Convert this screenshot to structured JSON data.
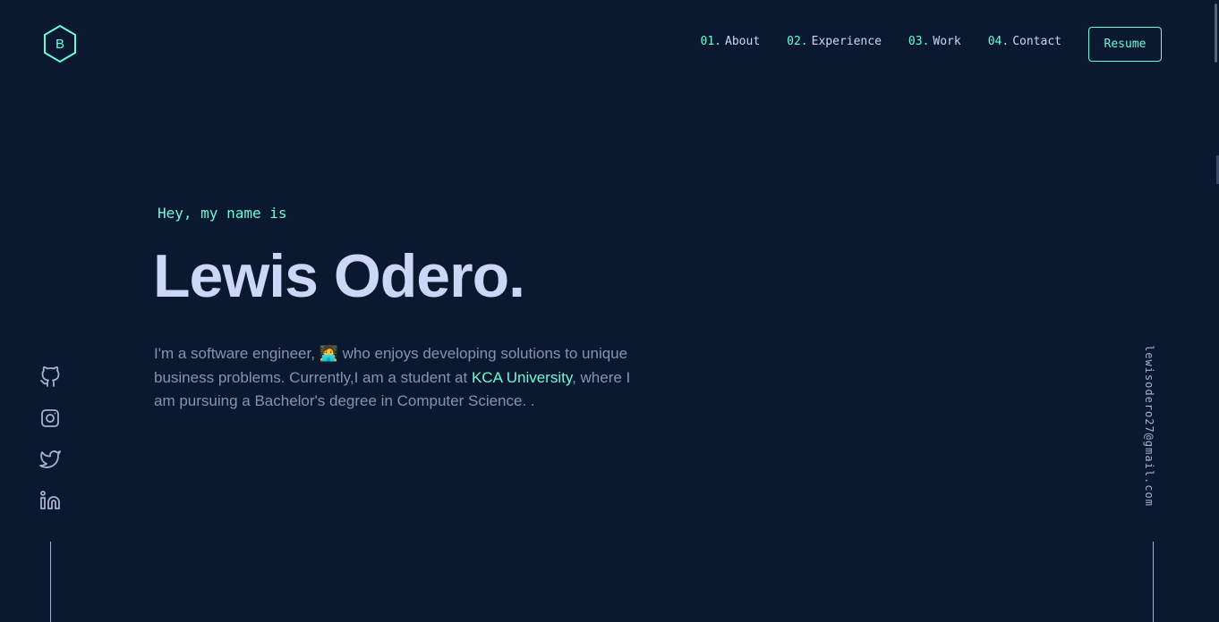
{
  "logo": {
    "letter": "B"
  },
  "nav": {
    "items": [
      {
        "num": "01.",
        "label": "About"
      },
      {
        "num": "02.",
        "label": "Experience"
      },
      {
        "num": "03.",
        "label": "Work"
      },
      {
        "num": "04.",
        "label": "Contact"
      }
    ],
    "resume_label": "Resume"
  },
  "hero": {
    "intro": "Hey, my name is",
    "name": "Lewis Odero.",
    "bio_part1": "I'm a software engineer,",
    "bio_emoji": "🧑‍💻",
    "bio_part2": " who enjoys developing solutions to unique business problems. Currently,I am a student at ",
    "bio_link": "KCA University",
    "bio_part3": ", where I am pursuing a Bachelor's degree in Computer Science. ."
  },
  "social": {
    "icons": [
      "github-icon",
      "instagram-icon",
      "twitter-icon",
      "linkedin-icon"
    ]
  },
  "email": "lewisodero27@gmail.com",
  "colors": {
    "background": "#0a192f",
    "accent": "#64ffda",
    "heading": "#ccd6f6",
    "body": "#8892b0"
  }
}
